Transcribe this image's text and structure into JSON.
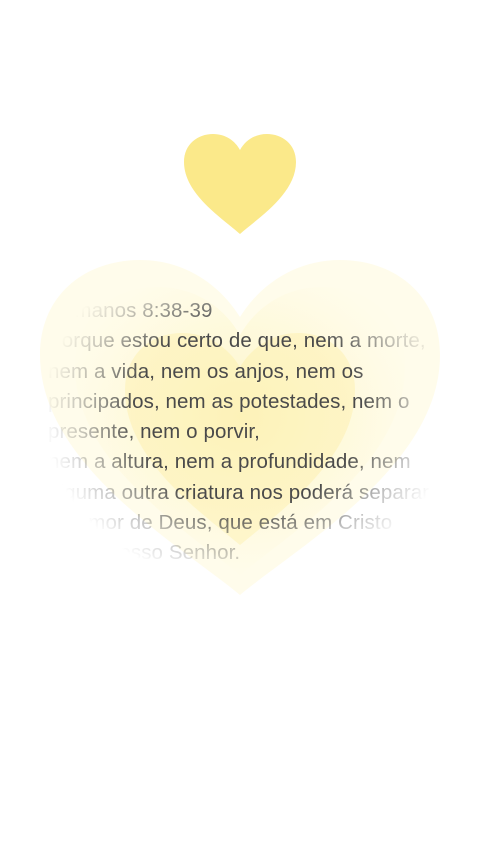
{
  "verse": {
    "reference": "Romanos 8:38-39",
    "body": "Porque estou certo de que, nem a morte, nem a vida, nem os anjos, nem os principados, nem as potestades, nem o presente, nem o porvir,\nnem a altura, nem a profundidade, nem alguma outra criatura nos poderá separar do amor de Deus, que está em Cristo Jesus nosso Senhor."
  },
  "icons": {
    "top": "heart-icon",
    "background": "glowing-heart-icon"
  },
  "colors": {
    "background": "#ffffff",
    "heart": "#fbe98a",
    "heart_glow": "#fdf3b8",
    "text": "#4a4a4a"
  }
}
